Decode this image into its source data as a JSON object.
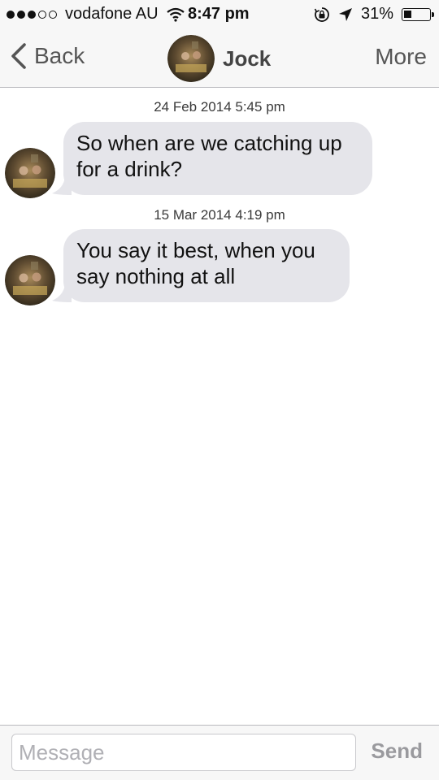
{
  "status_bar": {
    "signal_dots_filled": 3,
    "signal_dots_total": 5,
    "carrier": "vodafone AU",
    "time": "8:47 pm",
    "battery_percent": "31%",
    "battery_level": 0.31,
    "icons": [
      "wifi-icon",
      "rotation-lock-icon",
      "location-arrow-icon",
      "battery-icon"
    ]
  },
  "nav": {
    "back_label": "Back",
    "contact_name": "Jock",
    "more_label": "More"
  },
  "conversation": [
    {
      "timestamp": "24 Feb 2014 5:45 pm",
      "text": "So when are we catching up for a drink?"
    },
    {
      "timestamp": "15 Mar 2014 4:19 pm",
      "text": "You say it best, when you say nothing at all"
    }
  ],
  "composer": {
    "placeholder": "Message",
    "value": "",
    "send_label": "Send"
  },
  "colors": {
    "bubble_incoming": "#e5e5ea",
    "bar_background": "#f7f7f7",
    "send_disabled": "#9a9a9e"
  }
}
